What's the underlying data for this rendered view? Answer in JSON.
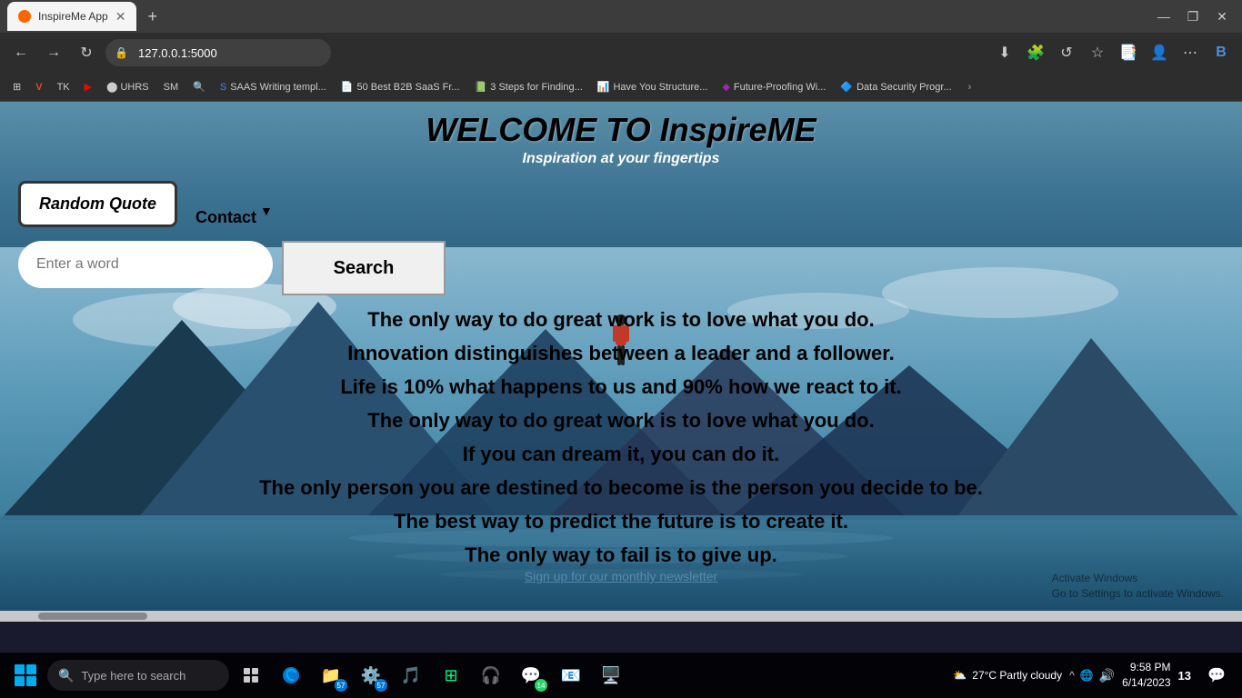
{
  "browser": {
    "tab_title": "InspireMe App",
    "address": "127.0.0.1:5000",
    "new_tab_label": "+",
    "window_controls": [
      "—",
      "❐",
      "✕"
    ]
  },
  "bookmarks": [
    {
      "label": "SAAS Writing templ...",
      "color": "#4285f4"
    },
    {
      "label": "50 Best B2B SaaS Fr...",
      "color": "#e94235"
    },
    {
      "label": "3 Steps for Finding...",
      "color": "#34a853"
    },
    {
      "label": "Have You Structure...",
      "color": "#888"
    },
    {
      "label": "Future-Proofing Wi...",
      "color": "#9c27b0"
    },
    {
      "label": "Data Security Progr...",
      "color": "#00bcd4"
    }
  ],
  "site": {
    "title": "WELCOME TO InspireME",
    "subtitle": "Inspiration at your fingertips"
  },
  "nav": {
    "random_quote_label": "Random Quote",
    "contact_label": "Contact"
  },
  "search": {
    "placeholder": "Enter a word",
    "button_label": "Search"
  },
  "quotes": [
    "The only way to do great work is to love what you do.",
    "Innovation distinguishes between a leader and a follower.",
    "Life is 10% what happens to us and 90% how we react to it.",
    "The only way to do great work is to love what you do.",
    "If you can dream it, you can do it.",
    "The only person you are destined to become is the person you decide to be.",
    "The best way to predict the future is to create it.",
    "The only way to fail is to give up."
  ],
  "newsletter": {
    "label": "Sign up for our monthly newsletter"
  },
  "activate_windows": {
    "line1": "Activate Windows",
    "line2": "Go to Settings to activate Windows."
  },
  "taskbar": {
    "search_placeholder": "Type here to search",
    "weather": "27°C  Partly cloudy",
    "time": "9:58 PM",
    "date": "6/14/2023",
    "language": "13"
  }
}
